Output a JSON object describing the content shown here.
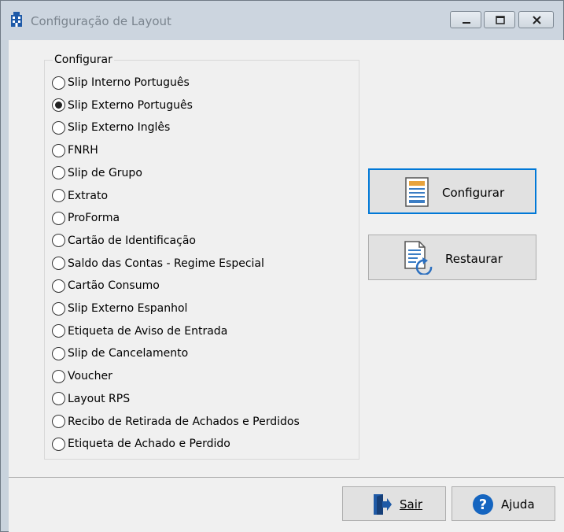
{
  "window": {
    "title": "Configuração de Layout",
    "icon": "building-app-icon"
  },
  "window_controls": {
    "minimize_icon": "minimize-icon",
    "maximize_icon": "maximize-icon",
    "close_icon": "close-icon"
  },
  "group": {
    "title": "Configurar",
    "selected_index": 1,
    "options": [
      "Slip Interno Português",
      "Slip Externo Português",
      "Slip Externo Inglês",
      "FNRH",
      "Slip de Grupo",
      "Extrato",
      "ProForma",
      "Cartão de Identificação",
      "Saldo das Contas - Regime Especial",
      "Cartão Consumo",
      "Slip Externo Espanhol",
      "Etiqueta de Aviso de Entrada",
      "Slip de Cancelamento",
      "Voucher",
      "Layout RPS",
      "Recibo de Retirada de Achados e Perdidos",
      "Etiqueta de Achado e Perdido"
    ]
  },
  "actions": {
    "configure_label": "Configurar",
    "configure_icon": "document-layout-icon",
    "restore_label": "Restaurar",
    "restore_icon": "document-restore-icon"
  },
  "footer": {
    "exit_label": "Sair",
    "exit_icon": "exit-door-icon",
    "help_label": "Ajuda",
    "help_icon": "help-question-icon"
  },
  "colors": {
    "focus_border": "#0078d7",
    "help_icon_blue": "#1565c0"
  }
}
